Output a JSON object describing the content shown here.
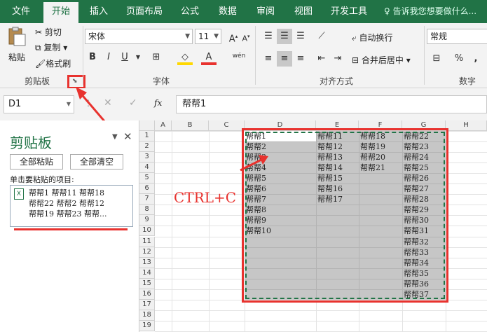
{
  "tabs": [
    "文件",
    "开始",
    "插入",
    "页面布局",
    "公式",
    "数据",
    "审阅",
    "视图",
    "开发工具"
  ],
  "tell_me": "告诉我您想要做什么...",
  "clipboard_group": {
    "paste": "粘贴",
    "cut": "剪切",
    "copy": "复制",
    "format_painter": "格式刷",
    "label": "剪贴板"
  },
  "font_group": {
    "font_name": "宋体",
    "font_size": "11",
    "label": "字体",
    "bold": "B",
    "italic": "I",
    "underline": "U",
    "phonetic": "wén"
  },
  "align_group": {
    "wrap": "自动换行",
    "merge": "合并后居中",
    "label": "对齐方式"
  },
  "number_group": {
    "format": "常规",
    "label": "数字"
  },
  "namebox": "D1",
  "formula_value": "帮帮1",
  "fx": "fx",
  "pane": {
    "title": "剪贴板",
    "paste_all": "全部粘贴",
    "clear_all": "全部清空",
    "hint": "单击要粘贴的项目:",
    "item_lines": [
      "帮帮1 帮帮11 帮帮18",
      "帮帮22 帮帮2 帮帮12",
      "帮帮19 帮帮23 帮帮..."
    ]
  },
  "annotation": "CTRL+C",
  "columns": [
    "A",
    "B",
    "C",
    "D",
    "E",
    "F",
    "G",
    "H"
  ],
  "rows": [
    "1",
    "2",
    "3",
    "4",
    "5",
    "6",
    "7",
    "8",
    "9",
    "10",
    "11",
    "12",
    "13",
    "14",
    "15",
    "16",
    "17",
    "18",
    "19"
  ],
  "col_D": [
    "帮帮1",
    "帮帮2",
    "帮帮3",
    "帮帮4",
    "帮帮5",
    "帮帮6",
    "帮帮7",
    "帮帮8",
    "帮帮9",
    "帮帮10"
  ],
  "col_E": [
    "帮帮11",
    "帮帮12",
    "帮帮13",
    "帮帮14",
    "帮帮15",
    "帮帮16",
    "帮帮17"
  ],
  "col_F": [
    "帮帮18",
    "帮帮19",
    "帮帮20",
    "帮帮21"
  ],
  "col_G": [
    "帮帮22",
    "帮帮23",
    "帮帮24",
    "帮帮25",
    "帮帮26",
    "帮帮27",
    "帮帮28",
    "帮帮29",
    "帮帮30",
    "帮帮31",
    "帮帮32",
    "帮帮33",
    "帮帮34",
    "帮帮35",
    "帮帮36",
    "帮帮37"
  ],
  "colors": {
    "accent": "#217346",
    "highlight": "#e8322e",
    "selection": "#c6c6c6"
  }
}
